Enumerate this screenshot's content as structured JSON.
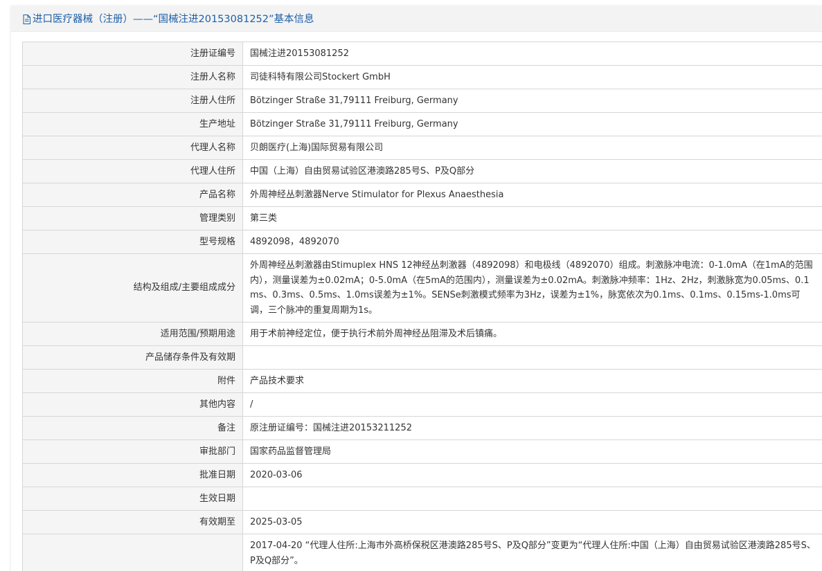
{
  "header": {
    "icon": "document-icon",
    "title": "进口医疗器械（注册）——“国械注进20153081252”基本信息"
  },
  "colors": {
    "title": "#1d5fa8",
    "label_bg": "#f5f5f5",
    "border": "#d6d6d6",
    "header_bg": "#f3f3f3"
  },
  "fields": [
    {
      "label": "注册证编号",
      "value": "国械注进20153081252"
    },
    {
      "label": "注册人名称",
      "value": "司徒科特有限公司Stockert GmbH"
    },
    {
      "label": "注册人住所",
      "value": "Bötzinger Straße 31,79111 Freiburg, Germany"
    },
    {
      "label": "生产地址",
      "value": "Bötzinger Straße 31,79111 Freiburg, Germany"
    },
    {
      "label": "代理人名称",
      "value": "贝朗医疗(上海)国际贸易有限公司"
    },
    {
      "label": "代理人住所",
      "value": "中国（上海）自由贸易试验区港澳路285号S、P及Q部分"
    },
    {
      "label": "产品名称",
      "value": "外周神经丛刺激器Nerve Stimulator for Plexus Anaesthesia"
    },
    {
      "label": "管理类别",
      "value": "第三类"
    },
    {
      "label": "型号规格",
      "value": "4892098，4892070"
    },
    {
      "label": "结构及组成/主要组成成分",
      "value": "外周神经丛刺激器由Stimuplex HNS 12神经丛刺激器（4892098）和电极线（4892070）组成。刺激脉冲电流：0-1.0mA（在1mA的范围内），测量误差为±0.02mA；0-5.0mA（在5mA的范围内），测量误差为±0.02mA。刺激脉冲频率：1Hz、2Hz，刺激脉宽为0.05ms、0.1ms、0.3ms、0.5ms、1.0ms误差为±1%。SENSe刺激模式频率为3Hz，误差为±1%，脉宽依次为0.1ms、0.1ms、0.15ms-1.0ms可调，三个脉冲的重复周期为1s。"
    },
    {
      "label": "适用范围/预期用途",
      "value": "用于术前神经定位，便于执行术前外周神经丛阻滞及术后镇痛。"
    },
    {
      "label": "产品储存条件及有效期",
      "value": ""
    },
    {
      "label": "附件",
      "value": "产品技术要求"
    },
    {
      "label": "其他内容",
      "value": "/"
    },
    {
      "label": "备注",
      "value": "原注册证编号：国械注进20153211252"
    },
    {
      "label": "审批部门",
      "value": "国家药品监督管理局"
    },
    {
      "label": "批准日期",
      "value": "2020-03-06"
    },
    {
      "label": "生效日期",
      "value": ""
    },
    {
      "label": "有效期至",
      "value": "2025-03-05"
    },
    {
      "label": "",
      "value": "2017-04-20 “代理人住所:上海市外高桥保税区港澳路285号S、P及Q部分”变更为“代理人住所:中国（上海）自由贸易试验区港澳路285号S、P及Q部分”。"
    }
  ]
}
